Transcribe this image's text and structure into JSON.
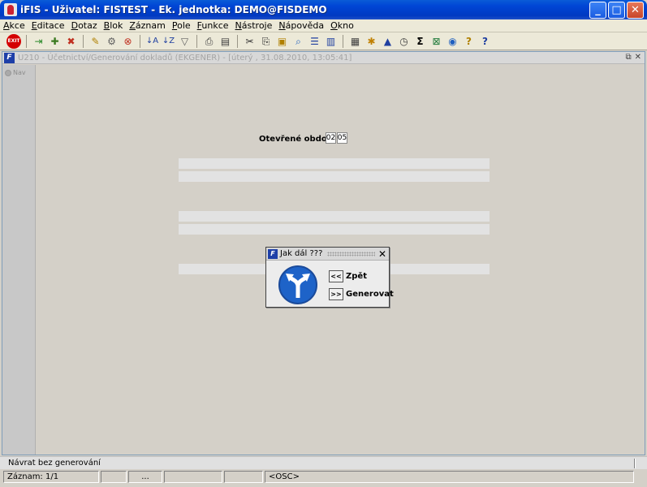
{
  "window": {
    "title": "iFIS - Uživatel: FISTEST - Ek. jednotka: DEMO@FISDEMO",
    "minimize": "_",
    "maximize": "□",
    "close": "✕"
  },
  "menu": [
    "Akce",
    "Editace",
    "Dotaz",
    "Blok",
    "Záznam",
    "Pole",
    "Funkce",
    "Nástroje",
    "Nápověda",
    "Okno"
  ],
  "toolbar": {
    "exit_label": "EXIT"
  },
  "form_window": {
    "title": "U210 - Účetnictví/Generování dokladů (EKGENER) - [úterý , 31.08.2010, 13:05:41]",
    "nav_label": "Nav"
  },
  "form": {
    "period_label": "Otevřené období",
    "period_month": "02",
    "period_day": "05"
  },
  "dialog": {
    "title": "Jak dál ???",
    "back_button": "<<",
    "back_label": "Zpět",
    "generate_button": ">>",
    "generate_label": "Generovat"
  },
  "status": {
    "message": "Návrat bez generování",
    "record": "Záznam: 1/1",
    "field3": "...",
    "mode": "<OSC>"
  }
}
